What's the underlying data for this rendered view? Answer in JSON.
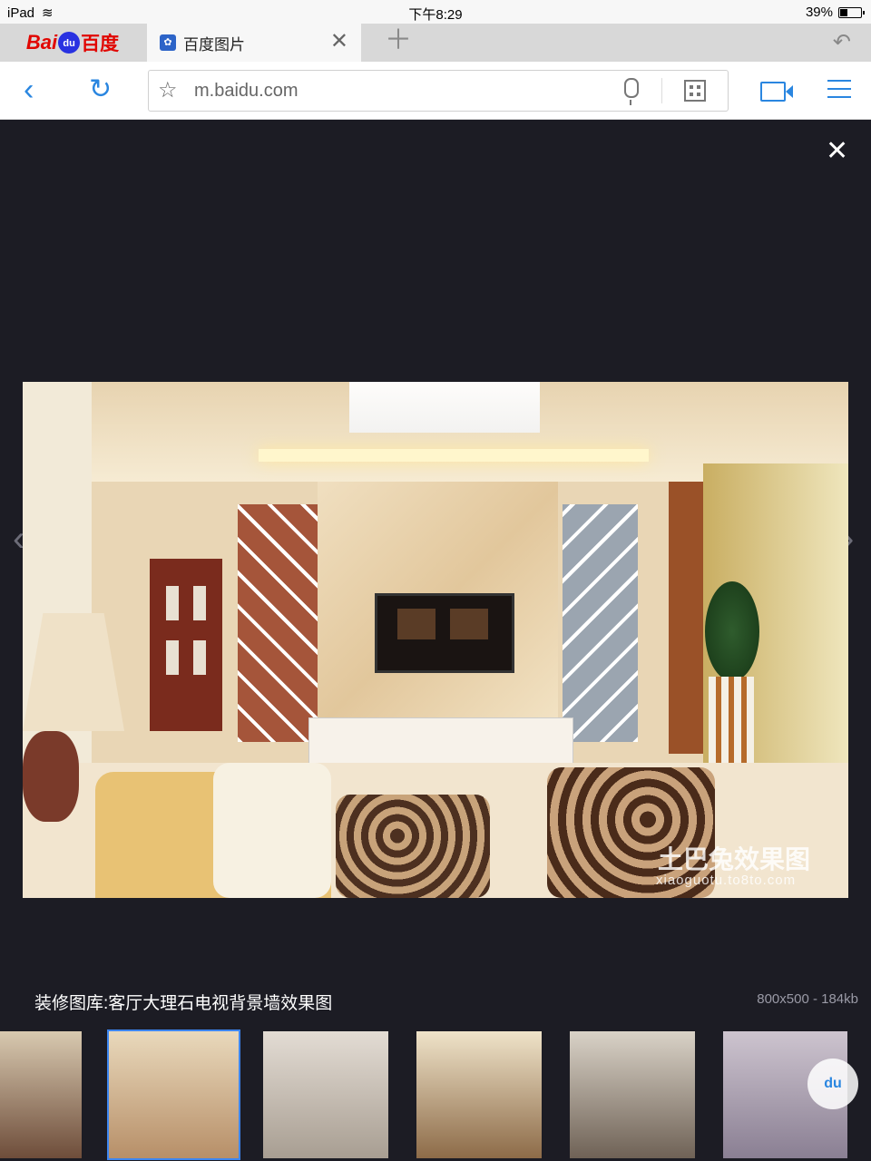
{
  "status": {
    "device": "iPad",
    "time": "下午8:29",
    "battery": "39%",
    "battery_level": 0.39
  },
  "tabbar": {
    "logo": {
      "part1": "Bai",
      "paw": "du",
      "part2": "百度"
    },
    "active_tab": {
      "title": "百度图片"
    }
  },
  "address": {
    "url": "m.baidu.com"
  },
  "viewer": {
    "watermark_cn": "土巴兔效果图",
    "watermark_url": "xiaoguotu.to8to.com",
    "caption": "装修图库:客厅大理石电视背景墙效果图",
    "meta": "800x500 - 184kb",
    "selected_thumbnail_index": 1,
    "thumbnail_count": 6
  },
  "floating_button": {
    "label": "du"
  }
}
